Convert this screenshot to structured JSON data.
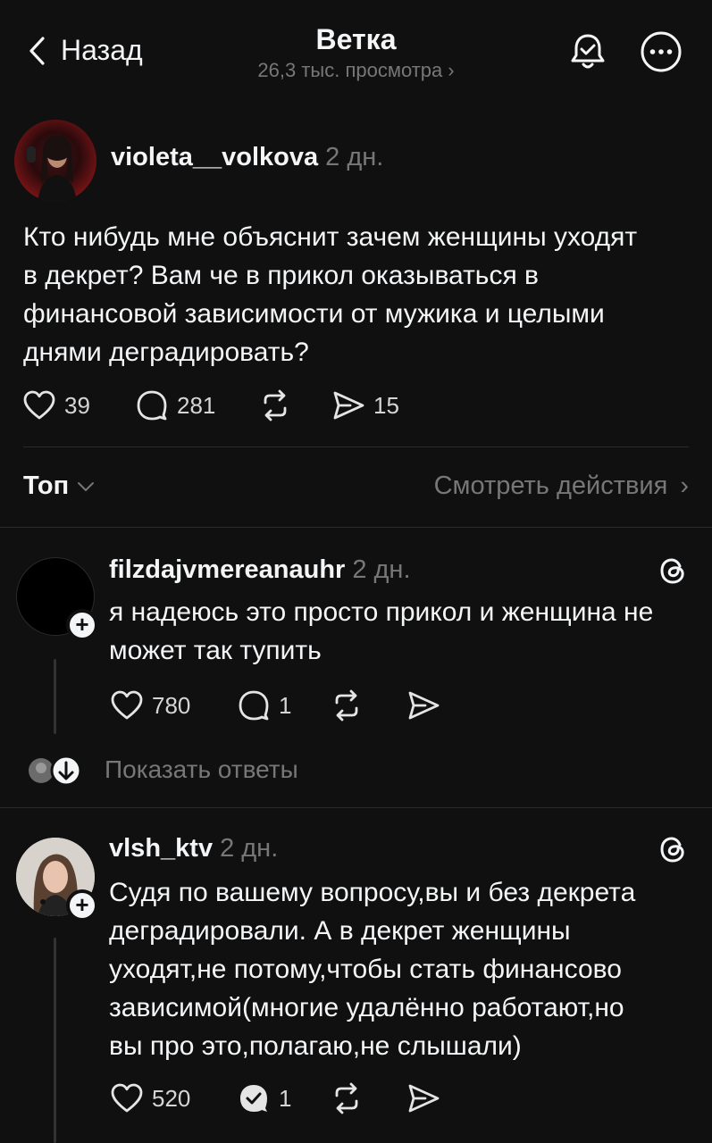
{
  "header": {
    "back_label": "Назад",
    "title": "Ветка",
    "views": "26,3 тыс. просмотра"
  },
  "post": {
    "username": "violeta__volkova",
    "time": "2 дн.",
    "text_lines": [
      "Кто нибудь мне объяснит зачем женщины уходят",
      "в декрет? Вам че в прикол оказываться в",
      "финансовой зависимости от мужика и целыми",
      "днями деградировать?"
    ],
    "likes": "39",
    "comments": "281",
    "shares": "15"
  },
  "sort": {
    "label": "Топ",
    "activity_label": "Смотреть действия"
  },
  "replies": [
    {
      "username": "filzdajvmereanauhr",
      "time": "2 дн.",
      "text_lines": [
        "я надеюсь это просто прикол и женщина не",
        "может так тупить"
      ],
      "likes": "780",
      "comments": "1",
      "show_replies": "Показать ответы"
    },
    {
      "username": "vlsh_ktv",
      "time": "2 дн.",
      "text_lines": [
        "Судя по вашему вопросу,вы и без декрета",
        "деградировали. А в декрет женщины",
        "уходят,не потому,чтобы стать финансово",
        "зависимой(многие удалённо работают,но",
        "вы про это,полагаю,не слышали)"
      ],
      "likes": "520",
      "comments": "1"
    }
  ],
  "colors": {
    "background": "#101010",
    "text": "#f3f5f7",
    "muted": "#777777"
  }
}
